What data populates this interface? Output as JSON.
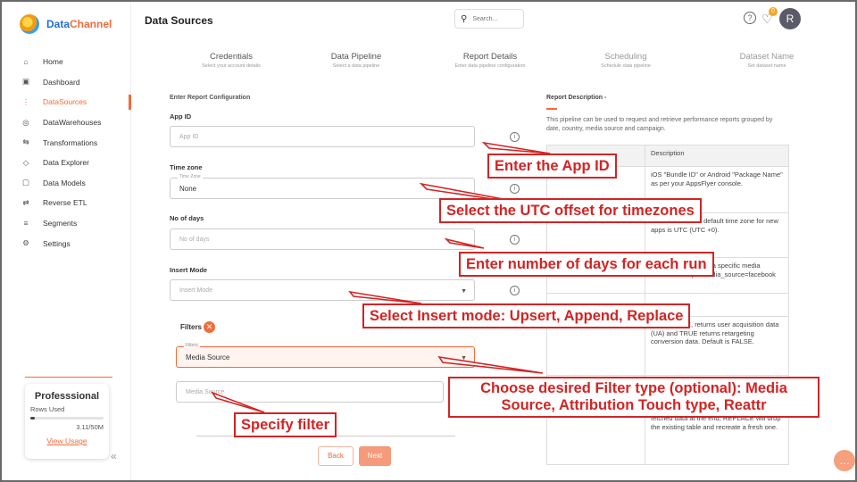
{
  "brand": {
    "name_part1": "Data",
    "name_part2": "Channel"
  },
  "sidebar": {
    "items": [
      {
        "label": "Home",
        "icon": "home-icon",
        "glyph": "⌂"
      },
      {
        "label": "Dashboard",
        "icon": "dashboard-icon",
        "glyph": "▣"
      },
      {
        "label": "DataSources",
        "icon": "datasources-icon",
        "glyph": "⋮"
      },
      {
        "label": "DataWarehouses",
        "icon": "warehouse-icon",
        "glyph": "◎"
      },
      {
        "label": "Transformations",
        "icon": "transform-icon",
        "glyph": "⇆"
      },
      {
        "label": "Data Explorer",
        "icon": "explorer-icon",
        "glyph": "◇"
      },
      {
        "label": "Data Models",
        "icon": "models-icon",
        "glyph": "▢"
      },
      {
        "label": "Reverse ETL",
        "icon": "reverse-etl-icon",
        "glyph": "⇄"
      },
      {
        "label": "Segments",
        "icon": "segments-icon",
        "glyph": "≡"
      },
      {
        "label": "Settings",
        "icon": "settings-icon",
        "glyph": "⚙"
      }
    ],
    "active_index": 2,
    "plan": {
      "title": "Professsional",
      "rows_used_label": "Rows Used",
      "rows_count": "3.11/50M",
      "rows_fraction": 0.062,
      "view_usage": "View Usage"
    },
    "collapse_glyph": "«"
  },
  "header": {
    "title": "Data Sources",
    "search_placeholder": "Search...",
    "help_glyph": "?",
    "bell_glyph": "🔔",
    "notification_count": "0",
    "avatar_initial": "R"
  },
  "steps": [
    {
      "title": "Credentials",
      "subtitle": "Select your account details"
    },
    {
      "title": "Data Pipeline",
      "subtitle": "Select a data pipeline"
    },
    {
      "title": "Report Details",
      "subtitle": "Enter data pipeline configuration"
    },
    {
      "title": "Scheduling",
      "subtitle": "Schedule data pipeline"
    },
    {
      "title": "Dataset Name",
      "subtitle": "Set dataset name"
    }
  ],
  "form": {
    "heading": "Enter Report Configuration",
    "app_id": {
      "label": "App ID",
      "placeholder": "App ID"
    },
    "time_zone": {
      "label": "Time zone",
      "float_label": "Time Zone",
      "value": "None"
    },
    "no_of_days": {
      "label": "No of days",
      "placeholder": "No of days"
    },
    "insert_mode": {
      "label": "Insert Mode",
      "placeholder": "Insert Mode"
    },
    "filters": {
      "label": "Filters",
      "remove_glyph": "✕",
      "float_label": "Filters",
      "value": "Media Source",
      "filter_placeholder": "Media Source"
    },
    "back_label": "Back",
    "next_label": "Next",
    "info_glyph": "i",
    "caret_glyph": "▼"
  },
  "description": {
    "title": "Report Description -",
    "text": "This pipeline can be used to request and retrieve performance reports grouped by date, country, media source and campaign.",
    "header_value": "Description",
    "rows": [
      {
        "key": "",
        "value": "iOS \"Bundle ID\" or Android \"Package Name\" as per your AppsFlyer console."
      },
      {
        "key": "",
        "value": "ou view one. The default time zone for new apps is UTC (UTC +0)."
      },
      {
        "key": "Media Source",
        "value": "Use to limit (filter) to a specific media source. Example:media_source=facebook"
      },
      {
        "key": "",
        "value": ""
      },
      {
        "key": "Reattr",
        "value": "When FALSE, returns user acquisition data (UA) and TRUE returns retargeting conversion data. Default is FALSE."
      },
      {
        "key": "",
        "value": ""
      },
      {
        "key": "Insert Mode",
        "value": "UPSERT will insert only new records or records with changes; APPEND will insert all fetched data at the end; REPLACE will drop the existing table and recreate a fresh one."
      }
    ]
  },
  "annotations": {
    "app_id": "Enter the App ID",
    "timezone": "Select the UTC offset for timezones",
    "days": "Enter number of days for each run",
    "insert_mode": "Select Insert mode: Upsert, Append, Replace",
    "filter_type": "Choose desired Filter type (optional): Media Source, Attribution Touch type, Reattr",
    "specify_filter": "Specify filter"
  },
  "colors": {
    "accent": "#f26b3a",
    "annotation": "#d32424",
    "brand_blue": "#1e6fd9"
  },
  "chat_glyph": "…"
}
